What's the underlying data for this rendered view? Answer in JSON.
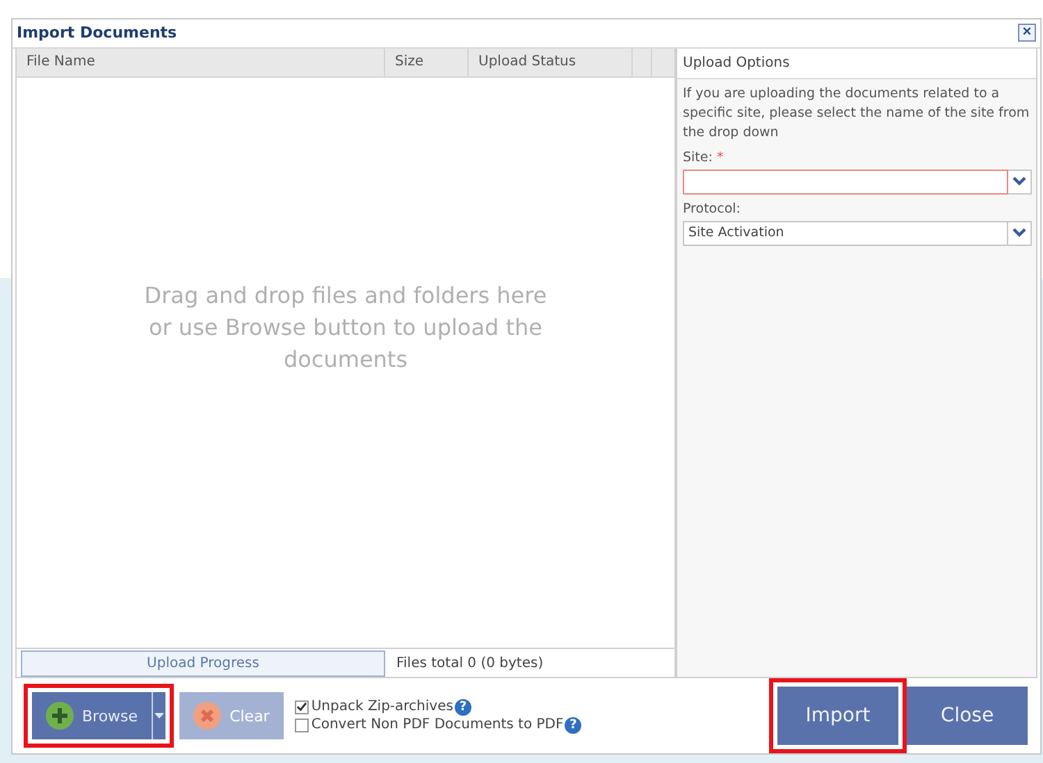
{
  "window": {
    "title": "Import Documents",
    "close": "×"
  },
  "file_table": {
    "columns": [
      {
        "label": "File Name"
      },
      {
        "label": "Size"
      },
      {
        "label": "Upload Status"
      }
    ],
    "drop_hint": "Drag and drop files and folders here or use Browse button to upload the documents"
  },
  "upload_progress": {
    "label": "Upload Progress",
    "files_total": "Files total 0 (0 bytes)"
  },
  "upload_options": {
    "title": "Upload Options",
    "description": "If you are uploading the documents related to a specific site, please select the name of the site from the drop down",
    "fields": [
      {
        "label": "Site:",
        "required": "*",
        "invalid": true
      },
      {
        "label": "Protocol:",
        "value": "Site Activation",
        "invalid": false
      }
    ]
  },
  "toolbar": {
    "buttons": [
      {
        "kind": "browse",
        "label": "Browse",
        "disabled": false,
        "highlighted": true
      },
      {
        "kind": "clear",
        "label": "Clear",
        "disabled": true,
        "highlighted": false
      }
    ],
    "options": [
      {
        "label": "Unpack Zip-archives",
        "checked": true,
        "help": "?"
      },
      {
        "label": "Convert Non PDF Documents to PDF",
        "checked": false,
        "help": "?"
      }
    ]
  },
  "actions": [
    {
      "label": "Import",
      "highlighted": true
    },
    {
      "label": "Close",
      "highlighted": false
    }
  ]
}
